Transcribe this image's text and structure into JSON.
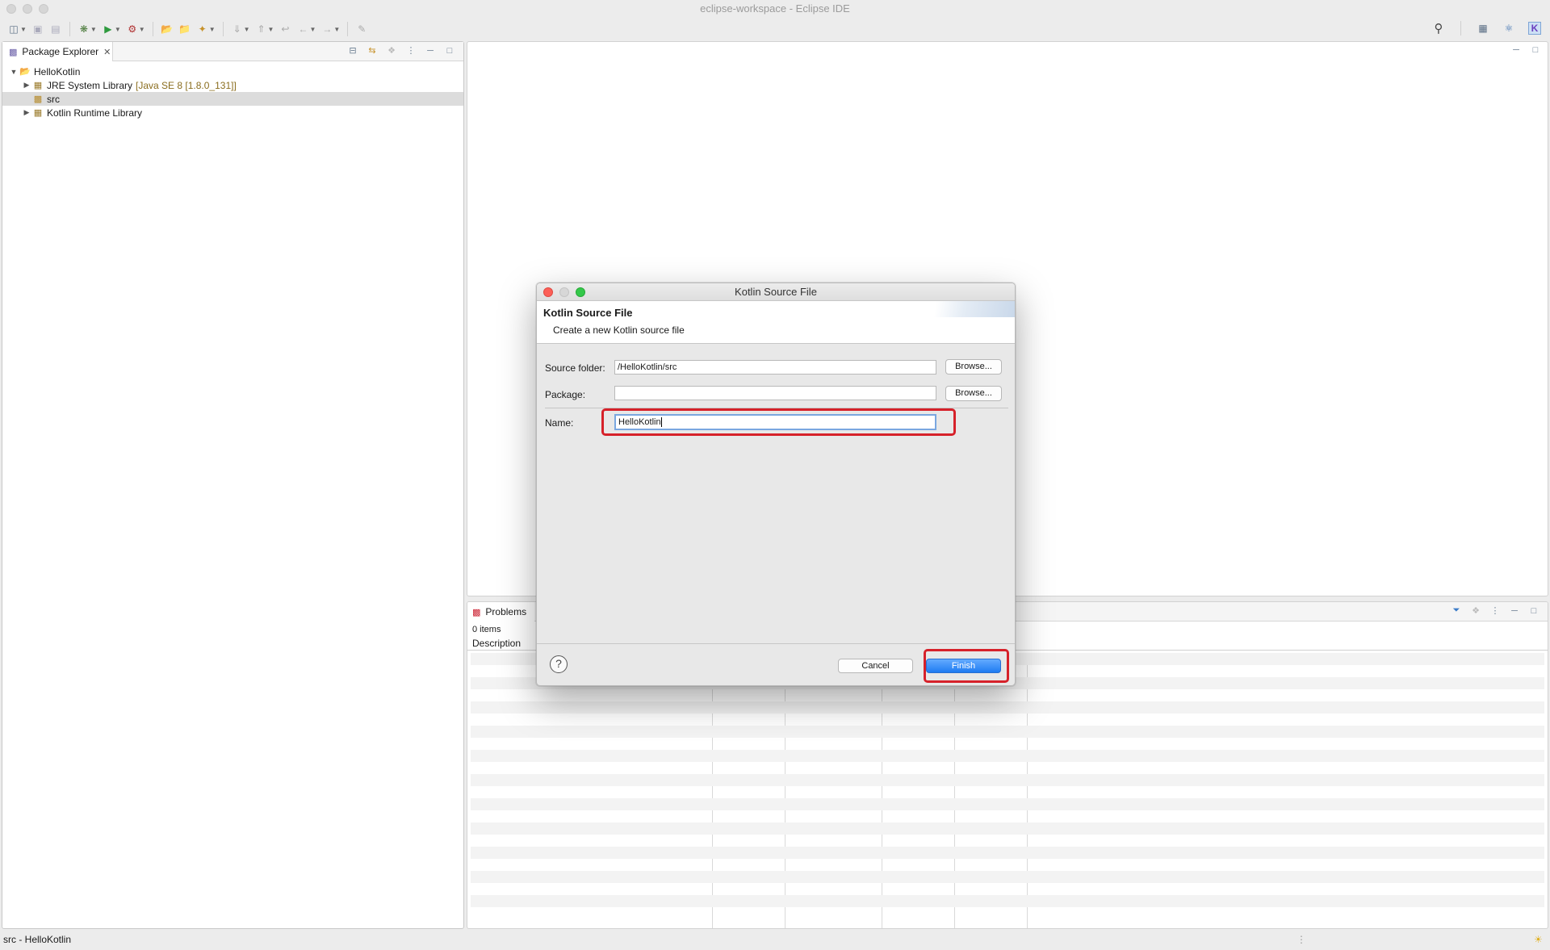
{
  "window": {
    "title": "eclipse-workspace - Eclipse IDE"
  },
  "package_explorer": {
    "tab_label": "Package Explorer",
    "tree": {
      "project": "HelloKotlin",
      "jre_label": "JRE System Library",
      "jre_decoration": "[Java SE 8 [1.8.0_131]]",
      "src_label": "src",
      "kotlin_runtime_label": "Kotlin Runtime Library"
    }
  },
  "problems": {
    "tab_label": "Problems",
    "item_count": "0 items",
    "column_description": "Description"
  },
  "status_bar": {
    "text": "src - HelloKotlin"
  },
  "dialog": {
    "window_title": "Kotlin Source File",
    "banner_title": "Kotlin Source File",
    "banner_description": "Create a new Kotlin source file",
    "source_folder_label": "Source folder:",
    "source_folder_value": "/HelloKotlin/src",
    "package_label": "Package:",
    "package_value": "",
    "name_label": "Name:",
    "name_value": "HelloKotlin",
    "browse_label": "Browse...",
    "cancel_label": "Cancel",
    "finish_label": "Finish",
    "help_symbol": "?"
  },
  "colors": {
    "highlight": "#d6212a",
    "finish_button": "#1f7cf2",
    "selection": "#dcdcdc"
  }
}
